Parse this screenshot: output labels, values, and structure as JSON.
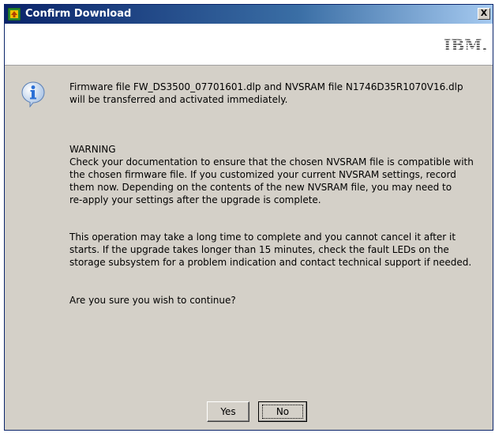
{
  "window": {
    "title": "Confirm Download",
    "close_label": "X"
  },
  "banner": {
    "logo_text": "IBM."
  },
  "message": {
    "intro": "Firmware file FW_DS3500_07701601.dlp and NVSRAM file N1746D35R1070V16.dlp\nwill be transferred and activated immediately.",
    "warning_heading": "WARNING",
    "warning_body": "Check your documentation to ensure that the chosen NVSRAM file is compatible with\nthe chosen firmware file. If you customized your current NVSRAM settings, record\nthem now. Depending on the contents of the new NVSRAM file, you may need to\nre-apply your settings after the upgrade is complete.",
    "duration_note": "This operation may take a long time to complete and you cannot cancel it after it\nstarts. If the upgrade takes longer than 15 minutes, check the fault LEDs on the\nstorage subsystem for a problem indication and contact technical support if needed.",
    "question": "Are you sure you wish to continue?"
  },
  "buttons": {
    "yes": "Yes",
    "no": "No"
  },
  "icons": {
    "title": "storage-manager-icon",
    "message": "info-icon",
    "logo": "ibm-logo"
  },
  "colors": {
    "titlebar_start": "#0a246a",
    "titlebar_end": "#a6caf0",
    "dialog_bg": "#d4d0c8",
    "info_icon": "#2a6fd6"
  }
}
